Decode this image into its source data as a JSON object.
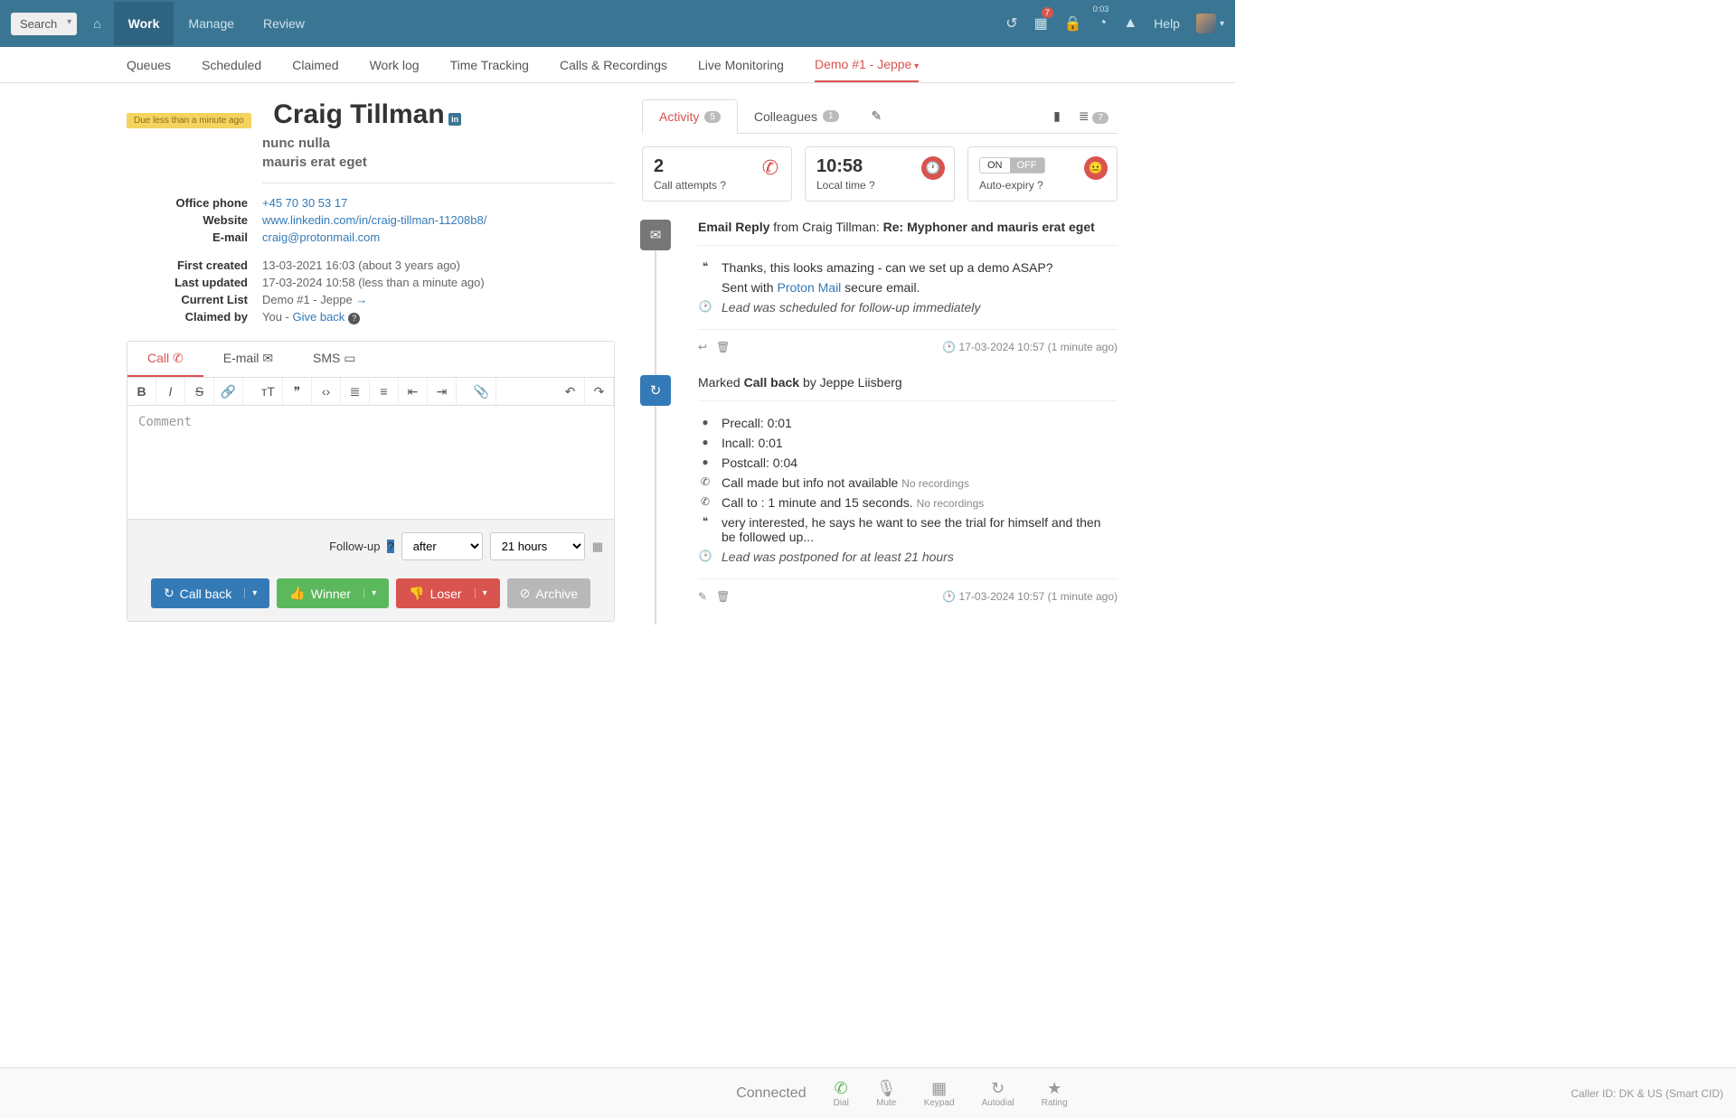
{
  "topbar": {
    "search": "Search",
    "nav": {
      "home": "",
      "work": "Work",
      "manage": "Manage",
      "review": "Review"
    },
    "cal_badge": "7",
    "timer": "0:03",
    "help": "Help"
  },
  "subnav": {
    "queues": "Queues",
    "scheduled": "Scheduled",
    "claimed": "Claimed",
    "worklog": "Work log",
    "time": "Time Tracking",
    "calls": "Calls & Recordings",
    "live": "Live Monitoring",
    "active": "Demo #1 - Jeppe"
  },
  "lead": {
    "due": "Due less than a minute ago",
    "name": "Craig Tillman",
    "sub1": "nunc nulla",
    "sub2": "mauris erat eget",
    "phone_lbl": "Office phone",
    "phone": "+45 70 30 53 17",
    "web_lbl": "Website",
    "web": "www.linkedin.com/in/craig-tillman-11208b8/",
    "email_lbl": "E-mail",
    "email": "craig@protonmail.com",
    "created_lbl": "First created",
    "created": "13-03-2021 16:03 (about 3 years ago)",
    "updated_lbl": "Last updated",
    "updated": "17-03-2024 10:58 (less than a minute ago)",
    "list_lbl": "Current List",
    "list": "Demo #1 - Jeppe",
    "claimed_lbl": "Claimed by",
    "claimed_pre": "You - ",
    "claimed_link": "Give back"
  },
  "composer": {
    "tab_call": "Call",
    "tab_email": "E-mail",
    "tab_sms": "SMS",
    "placeholder": "Comment",
    "fu_lbl": "Follow-up",
    "fu_mode": "after",
    "fu_when": "21 hours",
    "b_callback": "Call back",
    "b_winner": "Winner",
    "b_loser": "Loser",
    "b_archive": "Archive"
  },
  "right": {
    "tab_activity": "Activity",
    "act_n": "5",
    "tab_coll": "Colleagues",
    "coll_n": "1",
    "list_n": "7",
    "stat_calls_n": "2",
    "stat_calls": "Call attempts",
    "stat_time_n": "10:58",
    "stat_time": "Local time",
    "stat_ae_on": "ON",
    "stat_ae_off": "OFF",
    "stat_ae": "Auto-expiry",
    "a1_pre": "Email Reply",
    "a1_mid": " from Craig Tillman: ",
    "a1_subj": "Re: Myphoner and mauris erat eget",
    "a1_q1": "Thanks, this looks amazing - can we set up a demo ASAP?",
    "a1_q2a": "Sent with ",
    "a1_q2l": "Proton Mail",
    "a1_q2b": " secure email.",
    "a1_note": "Lead was scheduled for follow-up immediately",
    "a1_ts": "17-03-2024 10:57 (1 minute ago)",
    "a2_pre": "Marked ",
    "a2_b": "Call back",
    "a2_suf": " by Jeppe Liisberg",
    "a2_pre1": "Precall: 0:01",
    "a2_pre2": "Incall: 0:01",
    "a2_pre3": "Postcall: 0:04",
    "a2_c1": "Call made but info not available",
    "a2_c1n": "No recordings",
    "a2_c2": "Call to : 1 minute and 15 seconds.",
    "a2_c2n": "No recordings",
    "a2_q": "very interested, he says he want to see the trial for himself and then be followed up...",
    "a2_note": "Lead was postponed for at least 21 hours",
    "a2_ts": "17-03-2024 10:57 (1 minute ago)"
  },
  "dial": {
    "status": "Connected",
    "dial": "Dial",
    "mute": "Mute",
    "keypad": "Keypad",
    "auto": "Autodial",
    "rating": "Rating",
    "cid": "Caller ID: DK & US (Smart CID)"
  }
}
